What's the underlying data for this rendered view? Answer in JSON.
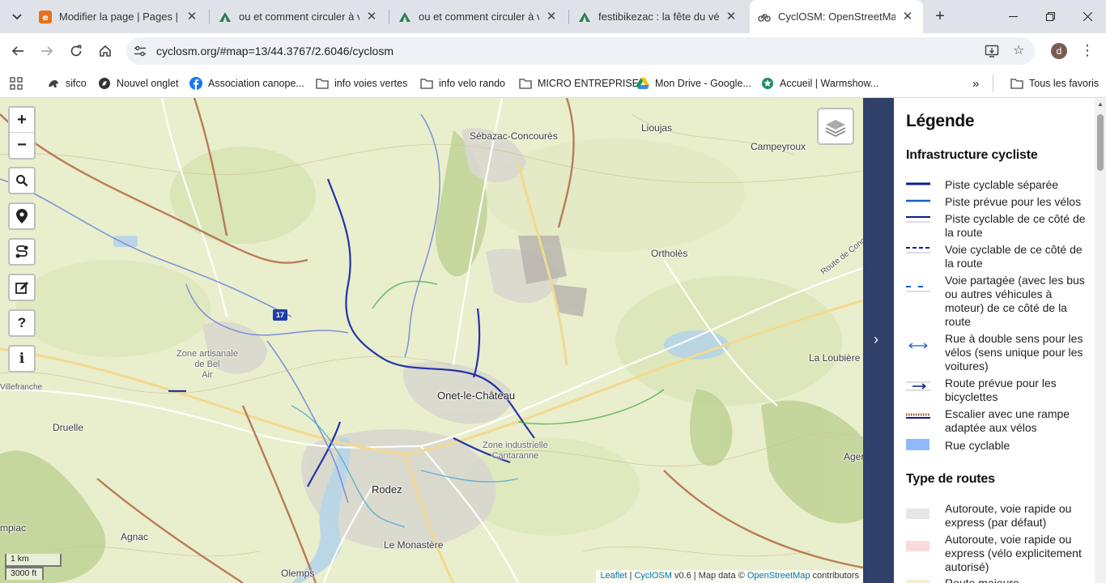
{
  "browser": {
    "tabs": [
      {
        "label": "Modifier la page | Pages | e-",
        "icon": "e-icon"
      },
      {
        "label": "ou et comment circuler à vél",
        "icon": "tent-icon"
      },
      {
        "label": "ou et comment circuler à vél",
        "icon": "tent-icon"
      },
      {
        "label": "festibikezac : la fête du vélo",
        "icon": "tent-icon"
      },
      {
        "label": "CyclOSM: OpenStreetMap-b",
        "icon": "bike-icon"
      }
    ],
    "url": "cyclosm.org/#map=13/44.3767/2.6046/cyclosm",
    "profile_initial": "d",
    "bookmarks": [
      {
        "label": "sifco"
      },
      {
        "label": "Nouvel onglet"
      },
      {
        "label": "Association canope..."
      },
      {
        "label": "info voies vertes"
      },
      {
        "label": "info velo rando"
      },
      {
        "label": "MICRO ENTREPRISE"
      },
      {
        "label": "Mon Drive - Google..."
      },
      {
        "label": "Accueil | Warmshow..."
      }
    ],
    "bookmarks_overflow": "»",
    "all_bookmarks": "Tous les favoris"
  },
  "map": {
    "zoom_in": "+",
    "zoom_out": "−",
    "places": {
      "sebazac": "Sébazac-Concourès",
      "lioujas": "Lioujas",
      "campeyroux": "Campeyroux",
      "ortholes": "Ortholès",
      "zone_bel_air": "Zone artisanale\nde Bel\nAir",
      "villefranche": "Villefranche",
      "onet": "Onet-le-Château",
      "la_loubiere": "La Loubière",
      "druelle": "Druelle",
      "zone_cantaranne": "Zone industrielle\nCantaranne",
      "rodez": "Rodez",
      "ager": "Ager",
      "mpiac": "mpiac",
      "agnac": "Agnac",
      "le_monastere": "Le Monastère",
      "olemps": "Olemps",
      "route_de_conques": "Route de Conques"
    },
    "road_badge": "17",
    "scale_metric": "1 km",
    "scale_imperial": "3000 ft",
    "attribution": {
      "leaflet": "Leaflet",
      "sep1": " | ",
      "cyclosm": "CyclOSM",
      "version": " v0.6 | Map data © ",
      "osm": "OpenStreetMap",
      "contributors": " contributors"
    }
  },
  "sidebar_toggle": "›",
  "legend": {
    "title": "Légende",
    "section_infra": "Infrastructure cycliste",
    "infra_items": [
      {
        "label": "Piste cyclable séparée"
      },
      {
        "label": "Piste prévue pour les vélos"
      },
      {
        "label": "Piste cyclable de ce côté de la route"
      },
      {
        "label": "Voie cyclable de ce côté de la route"
      },
      {
        "label": "Voie partagée (avec les bus ou autres véhicules à moteur) de ce côté de la route"
      },
      {
        "label": "Rue à double sens pour les vélos (sens unique pour les voitures)"
      },
      {
        "label": "Route prévue pour les bicyclettes"
      },
      {
        "label": "Escalier avec une rampe adaptée aux vélos"
      },
      {
        "label": "Rue cyclable"
      }
    ],
    "section_roads": "Type de routes",
    "road_items": [
      {
        "label": "Autoroute, voie rapide ou express (par défaut)"
      },
      {
        "label": "Autoroute, voie rapide ou express (vélo explicitement autorisé)"
      },
      {
        "label": "Route majeure"
      }
    ]
  },
  "colors": {
    "sidebar_toggle_bg": "#2f4069",
    "cycle_track": "#0d1f8a",
    "cycle_designated": "#1560c2",
    "cycle_street": "#8fb9ff",
    "motorway_default": "#e6e6e6",
    "motorway_allowed": "#f8dcdc"
  }
}
